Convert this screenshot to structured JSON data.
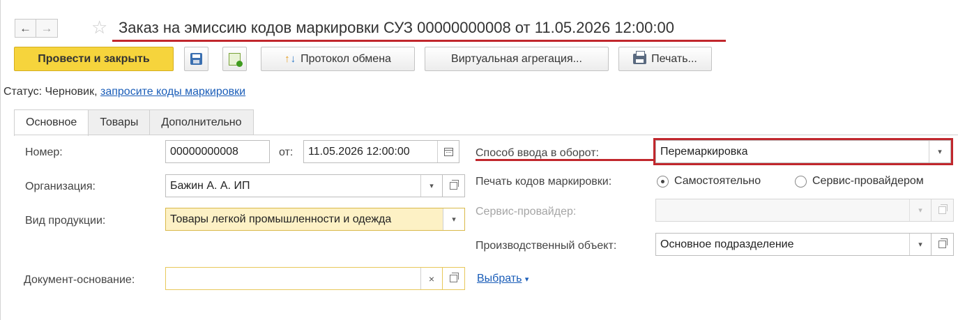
{
  "window": {
    "back_arrow": "←",
    "forward_arrow": "→",
    "favorite_star": "☆",
    "title": "Заказ на эмиссию кодов маркировки СУЗ 00000000008 от 11.05.2026 12:00:00"
  },
  "toolbar": {
    "post_and_close": "Провести и закрыть",
    "save_icon": "save-icon",
    "post_icon": "post-icon",
    "exchange_protocol": "Протокол обмена",
    "virtual_aggregation": "Виртуальная агрегация...",
    "print": "Печать..."
  },
  "status": {
    "prefix": "Статус: Черновик,",
    "link": "запросите коды маркировки"
  },
  "tabs": [
    {
      "label": "Основное",
      "active": true
    },
    {
      "label": "Товары",
      "active": false
    },
    {
      "label": "Дополнительно",
      "active": false
    }
  ],
  "form": {
    "number": {
      "label": "Номер:",
      "value": "00000000008"
    },
    "date": {
      "label": "от:",
      "value": "11.05.2026 12:00:00"
    },
    "organization": {
      "label": "Организация:",
      "value": "Бажин А. А. ИП"
    },
    "product_type": {
      "label": "Вид продукции:",
      "value": "Товары легкой промышленности и одежда"
    },
    "base_document": {
      "label": "Документ-основание:",
      "value": "",
      "clear_icon": "×"
    },
    "select_link": "Выбрать",
    "input_method": {
      "label": "Способ ввода в оборот:",
      "value": "Перемаркировка"
    },
    "print_codes": {
      "label": "Печать кодов маркировки:",
      "options": [
        "Самостоятельно",
        "Сервис-провайдером"
      ],
      "selected": "Самостоятельно"
    },
    "service_provider": {
      "label": "Сервис-провайдер:",
      "value": ""
    },
    "production_object": {
      "label": "Производственный объект:",
      "value": "Основное подразделение"
    },
    "dropdown_glyph": "▾"
  },
  "colors": {
    "primary_button": "#f6d43c",
    "highlight_red": "#c1272d",
    "link": "#1a5db8",
    "required_field": "#fdf1c5"
  }
}
